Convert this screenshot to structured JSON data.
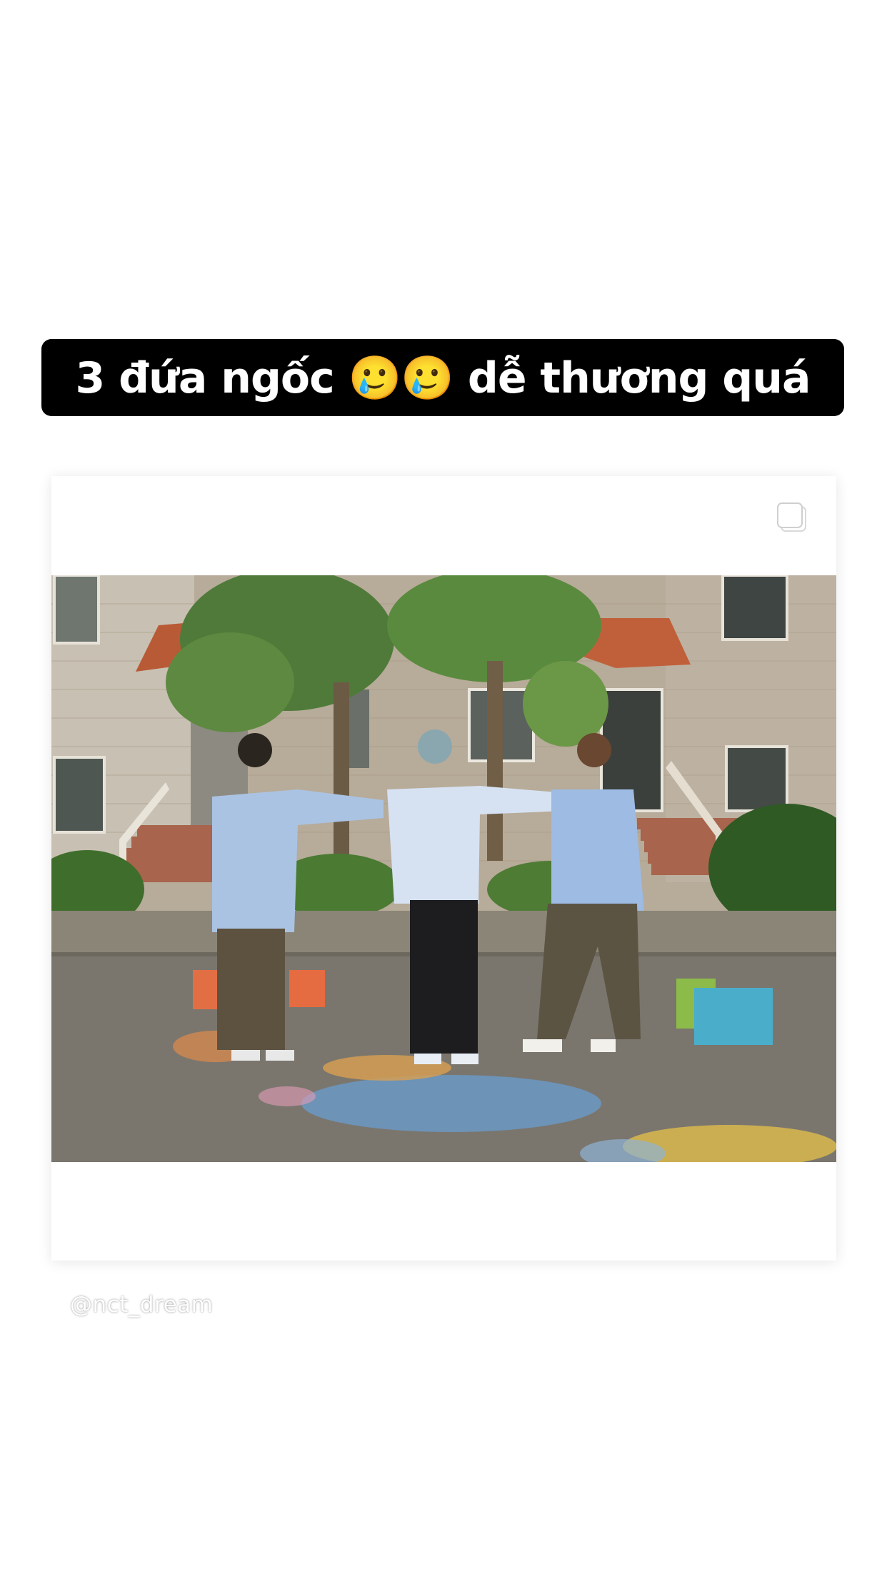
{
  "story": {
    "caption": "3 đứa ngốc 🥲🥲 dễ thương quá",
    "mention": "@nct_dream"
  },
  "post": {
    "icon": "multiple-posts-icon",
    "photo": "three people standing in front of brick building on street with chalk drawings"
  },
  "colors": {
    "caption_bg": "#000000",
    "caption_text": "#ffffff",
    "page_bg": "#ffffff"
  }
}
